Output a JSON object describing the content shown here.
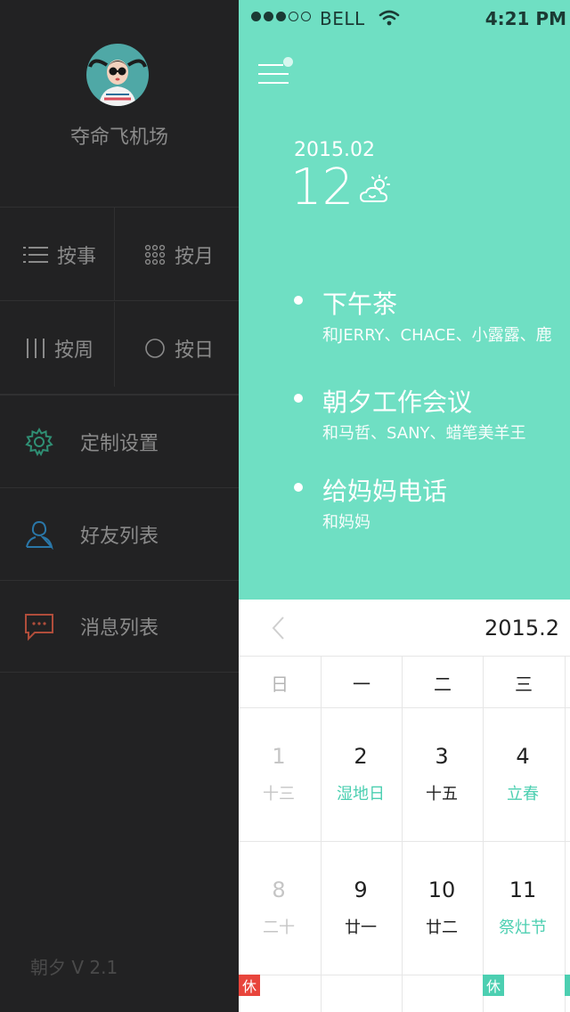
{
  "sidebar": {
    "username": "夺命飞机场",
    "views": [
      {
        "label": "按事",
        "icon": "list-icon"
      },
      {
        "label": "按月",
        "icon": "grid-icon"
      },
      {
        "label": "按周",
        "icon": "columns-icon"
      },
      {
        "label": "按日",
        "icon": "circle-icon"
      }
    ],
    "menu": [
      {
        "label": "定制设置",
        "icon": "gear-icon",
        "color": "#2f8f74"
      },
      {
        "label": "好友列表",
        "icon": "user-icon",
        "color": "#2a77a8"
      },
      {
        "label": "消息列表",
        "icon": "chat-icon",
        "color": "#b04d3b"
      }
    ],
    "version": "朝夕 V 2.1"
  },
  "status_bar": {
    "carrier": "BELL",
    "time": "4:21 PM"
  },
  "hero": {
    "date_ym": "2015.02",
    "date_day": "12",
    "weather_icon": "partly-sunny-icon",
    "accent": "#6fdfc3",
    "events": [
      {
        "title": "下午茶",
        "participants": "和JERRY、CHACE、小露露、鹿"
      },
      {
        "title": "朝夕工作会议",
        "participants": "和马哲、SANY、蜡笔美羊王"
      },
      {
        "title": "给妈妈电话",
        "participants": "和妈妈"
      }
    ]
  },
  "calendar": {
    "month": "2015.2",
    "weekdays": [
      "日",
      "一",
      "二",
      "三"
    ],
    "weeks": [
      [
        {
          "day": "1",
          "lunar": "十三",
          "muted": true
        },
        {
          "day": "2",
          "lunar": "湿地日",
          "green": true
        },
        {
          "day": "3",
          "lunar": "十五"
        },
        {
          "day": "4",
          "lunar": "立春",
          "green": true
        }
      ],
      [
        {
          "day": "8",
          "lunar": "二十",
          "muted": true
        },
        {
          "day": "9",
          "lunar": "廿一"
        },
        {
          "day": "10",
          "lunar": "廿二"
        },
        {
          "day": "11",
          "lunar": "祭灶节",
          "green": true
        }
      ]
    ],
    "rest_label": "休",
    "rest_colors": {
      "red": "#e8453c",
      "green": "#4ccfb1"
    }
  }
}
